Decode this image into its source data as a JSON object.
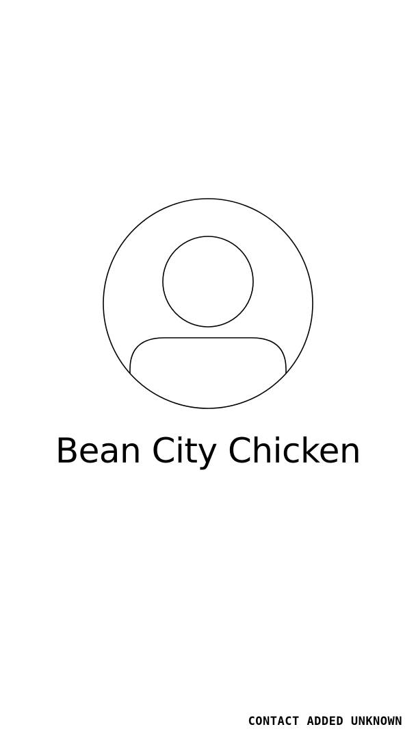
{
  "contact": {
    "name": "Bean City Chicken",
    "avatar_icon": "person-silhouette-icon"
  },
  "footer": {
    "status_text": "CONTACT ADDED UNKNOWN"
  },
  "colors": {
    "background": "#ffffff",
    "foreground": "#000000"
  }
}
